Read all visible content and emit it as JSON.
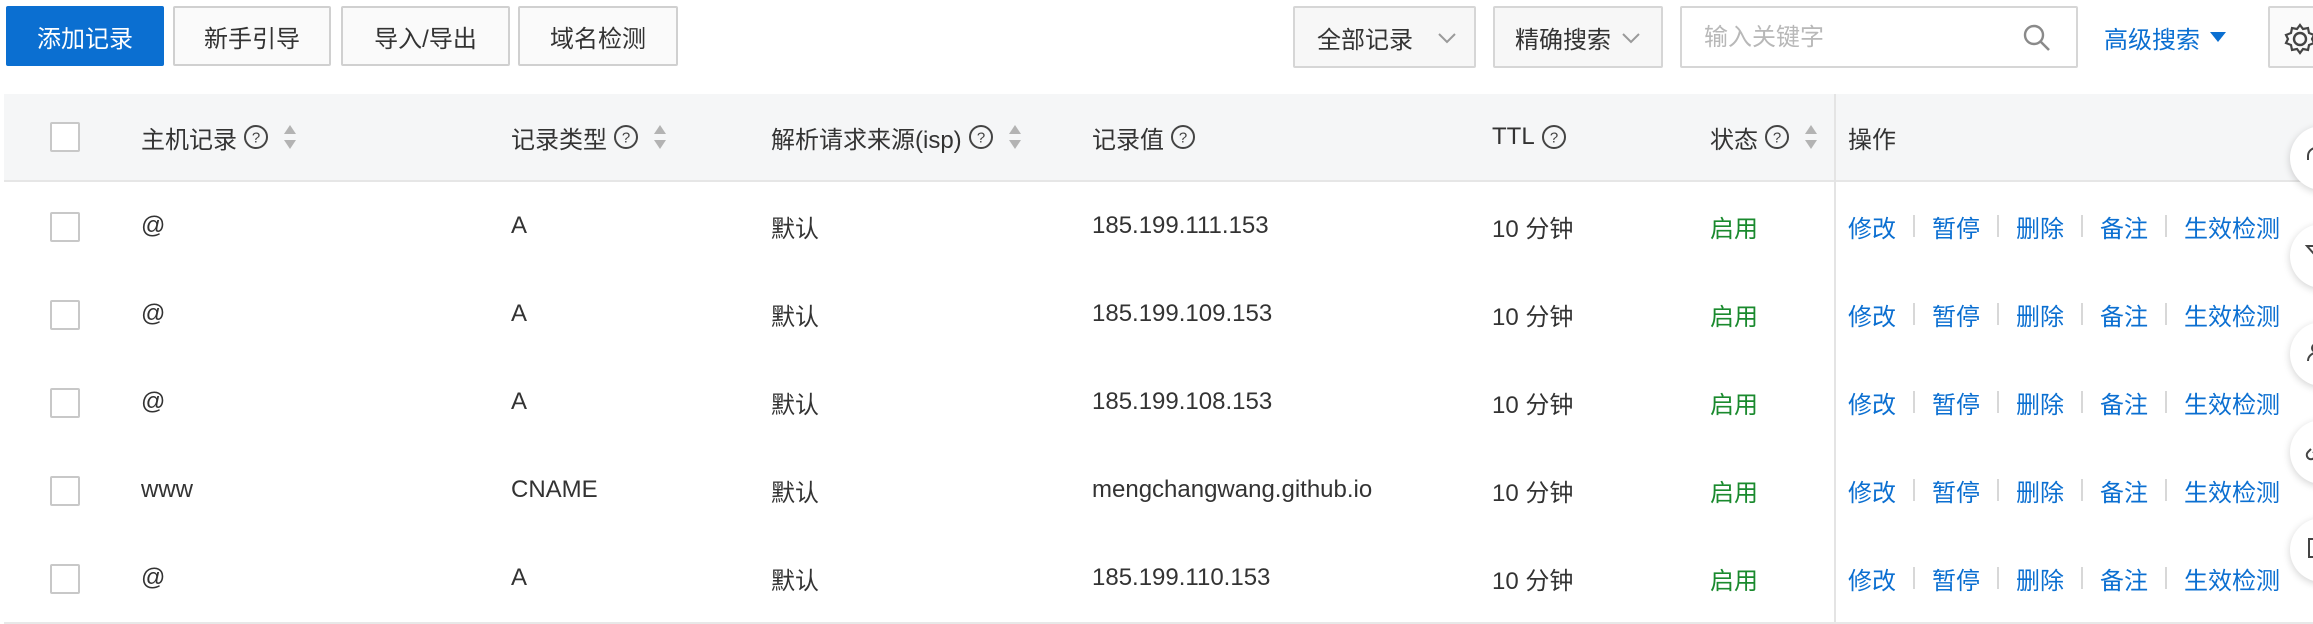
{
  "toolbar": {
    "add_record": "添加记录",
    "guide": "新手引导",
    "import_export": "导入/导出",
    "domain_check": "域名检测",
    "record_filter": "全部记录",
    "search_mode": "精确搜索",
    "search_placeholder": "输入关键字",
    "advanced_search": "高级搜索"
  },
  "table": {
    "headers": {
      "host": "主机记录",
      "type": "记录类型",
      "isp": "解析请求来源(isp)",
      "value": "记录值",
      "ttl": "TTL",
      "status": "状态",
      "ops": "操作"
    },
    "ops": [
      "修改",
      "暂停",
      "删除",
      "备注",
      "生效检测"
    ],
    "rows": [
      {
        "host": "@",
        "type": "A",
        "isp": "默认",
        "value": "185.199.111.153",
        "ttl": "10 分钟",
        "status": "启用"
      },
      {
        "host": "@",
        "type": "A",
        "isp": "默认",
        "value": "185.199.109.153",
        "ttl": "10 分钟",
        "status": "启用"
      },
      {
        "host": "@",
        "type": "A",
        "isp": "默认",
        "value": "185.199.108.153",
        "ttl": "10 分钟",
        "status": "启用"
      },
      {
        "host": "www",
        "type": "CNAME",
        "isp": "默认",
        "value": "mengchangwang.github.io",
        "ttl": "10 分钟",
        "status": "启用"
      },
      {
        "host": "@",
        "type": "A",
        "isp": "默认",
        "value": "185.199.110.153",
        "ttl": "10 分钟",
        "status": "启用"
      }
    ]
  },
  "colors": {
    "primary": "#0b6fd1",
    "status_enabled": "#1a8a2e",
    "header_bg": "#f5f6f7"
  },
  "icons": {
    "search": "search-icon",
    "help": "help-circle-icon",
    "sort": "sort-icon",
    "chevron": "chevron-down-icon",
    "caret": "caret-down-icon",
    "settings": "gear-icon"
  }
}
